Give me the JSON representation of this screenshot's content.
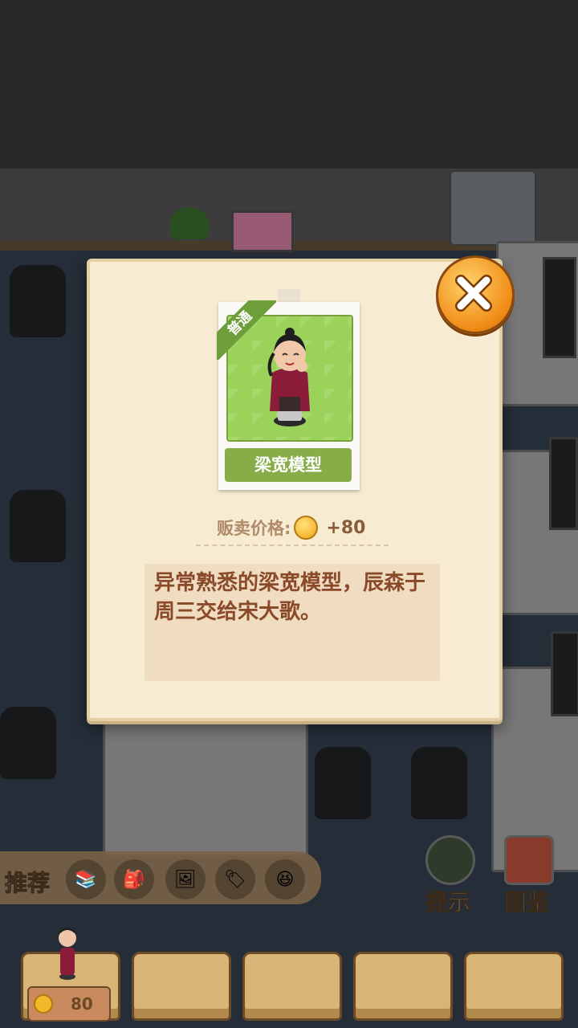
{
  "dialog": {
    "badge": "普通",
    "item_name": "梁宽模型",
    "price_label": "贩卖价格:",
    "price_value": "+80",
    "description": "异常熟悉的梁宽模型，辰森于周三交给宋大歌。"
  },
  "bottom_bar": {
    "recommend_label": "推荐",
    "hint_label": "提示",
    "catalog_label": "图鉴",
    "coin_count": "80"
  },
  "colors": {
    "panel_bg": "#f7ebd2",
    "green_accent": "#86ad47",
    "close_orange": "#f08a16",
    "text_brown": "#8a4a2a"
  },
  "icons": [
    "close-icon",
    "coin-icon",
    "hint-icon",
    "catalog-icon"
  ]
}
